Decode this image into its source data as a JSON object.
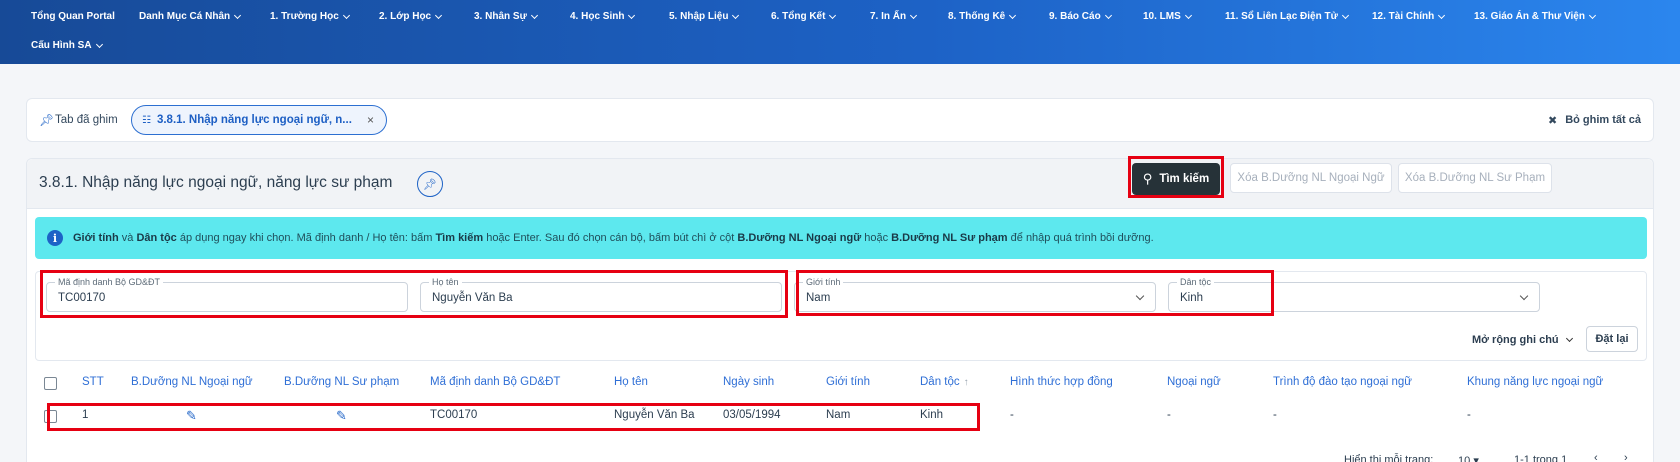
{
  "nav": {
    "items": [
      {
        "label": "Tổng Quan Portal",
        "dropdown": false
      },
      {
        "label": "Danh Mục Cá Nhân",
        "dropdown": true
      },
      {
        "label": "1. Trường Học",
        "dropdown": true
      },
      {
        "label": "2. Lớp Học",
        "dropdown": true
      },
      {
        "label": "3. Nhân Sự",
        "dropdown": true
      },
      {
        "label": "4. Học Sinh",
        "dropdown": true
      },
      {
        "label": "5. Nhập Liệu",
        "dropdown": true
      },
      {
        "label": "6. Tổng Kết",
        "dropdown": true
      },
      {
        "label": "7. In Ấn",
        "dropdown": true
      },
      {
        "label": "8. Thống Kê",
        "dropdown": true
      },
      {
        "label": "9. Báo Cáo",
        "dropdown": true
      },
      {
        "label": "10. LMS",
        "dropdown": true
      },
      {
        "label": "11. Sổ Liên Lạc Điện Tử",
        "dropdown": true
      },
      {
        "label": "12. Tài Chính",
        "dropdown": true
      },
      {
        "label": "13. Giáo Án & Thư Viện",
        "dropdown": true
      },
      {
        "label": "Cấu Hình SA",
        "dropdown": true
      }
    ]
  },
  "pinbar": {
    "label": "Tab đã ghim",
    "tab_label": "3.8.1. Nhập năng lực ngoại ngữ, n...",
    "close_glyph": "×",
    "unpin_all": "Bỏ ghim tất cả"
  },
  "page": {
    "title": "3.8.1. Nhập năng lực ngoại ngữ, năng lực sư phạm",
    "search_btn": "Tìm kiếm",
    "clear_lang_btn": "Xóa B.Dưỡng NL Ngoại Ngữ",
    "clear_ped_btn": "Xóa B.Dưỡng NL Sư Phạm"
  },
  "info": {
    "b1": "Giới tính",
    "t1": " và ",
    "b2": "Dân tộc",
    "t2": " áp dụng ngay khi chọn. Mã định danh / Họ tên: bấm ",
    "b3": "Tìm kiếm",
    "t3": " hoặc Enter. Sau đó chọn cán bộ, bấm bút chì ở cột ",
    "b4": "B.Dưỡng NL Ngoại ngữ",
    "t4": " hoặc ",
    "b5": "B.Dưỡng NL Sư phạm",
    "t5": " để nhập quá trình bồi dưỡng."
  },
  "filters": {
    "id_label": "Mã định danh Bộ GD&ĐT",
    "id_value": "TC00170",
    "name_label": "Họ tên",
    "name_value": "Nguyễn Văn Ba",
    "gender_label": "Giới tính",
    "gender_value": "Nam",
    "ethnic_label": "Dân tộc",
    "ethnic_value": "Kinh",
    "expand_label": "Mở rộng ghi chú",
    "reset_label": "Đặt lại"
  },
  "table": {
    "headers": {
      "stt": "STT",
      "lang": "B.Dưỡng NL Ngoại ngữ",
      "ped": "B.Dưỡng NL Sư phạm",
      "id": "Mã định danh Bộ GD&ĐT",
      "name": "Họ tên",
      "dob": "Ngày sinh",
      "gender": "Giới tính",
      "ethnic": "Dân tộc",
      "contract": "Hình thức hợp đồng",
      "foreign": "Ngoại ngữ",
      "level": "Trình độ đào tạo ngoại ngữ",
      "frame": "Khung năng lực ngoại ngữ"
    },
    "rows": [
      {
        "stt": "1",
        "id": "TC00170",
        "name": "Nguyễn Văn Ba",
        "dob": "03/05/1994",
        "gender": "Nam",
        "ethnic": "Kinh",
        "contract": "-",
        "foreign": "-",
        "level": "-",
        "frame": "-"
      }
    ]
  },
  "pager": {
    "per_page_label": "Hiển thị mỗi trang:",
    "per_page_value": "10",
    "range": "1-1 trong 1"
  },
  "colors": {
    "nav_start": "#174a97",
    "nav_end": "#2b86ee",
    "info_bg": "#5de8ee",
    "highlight": "#e60012"
  }
}
